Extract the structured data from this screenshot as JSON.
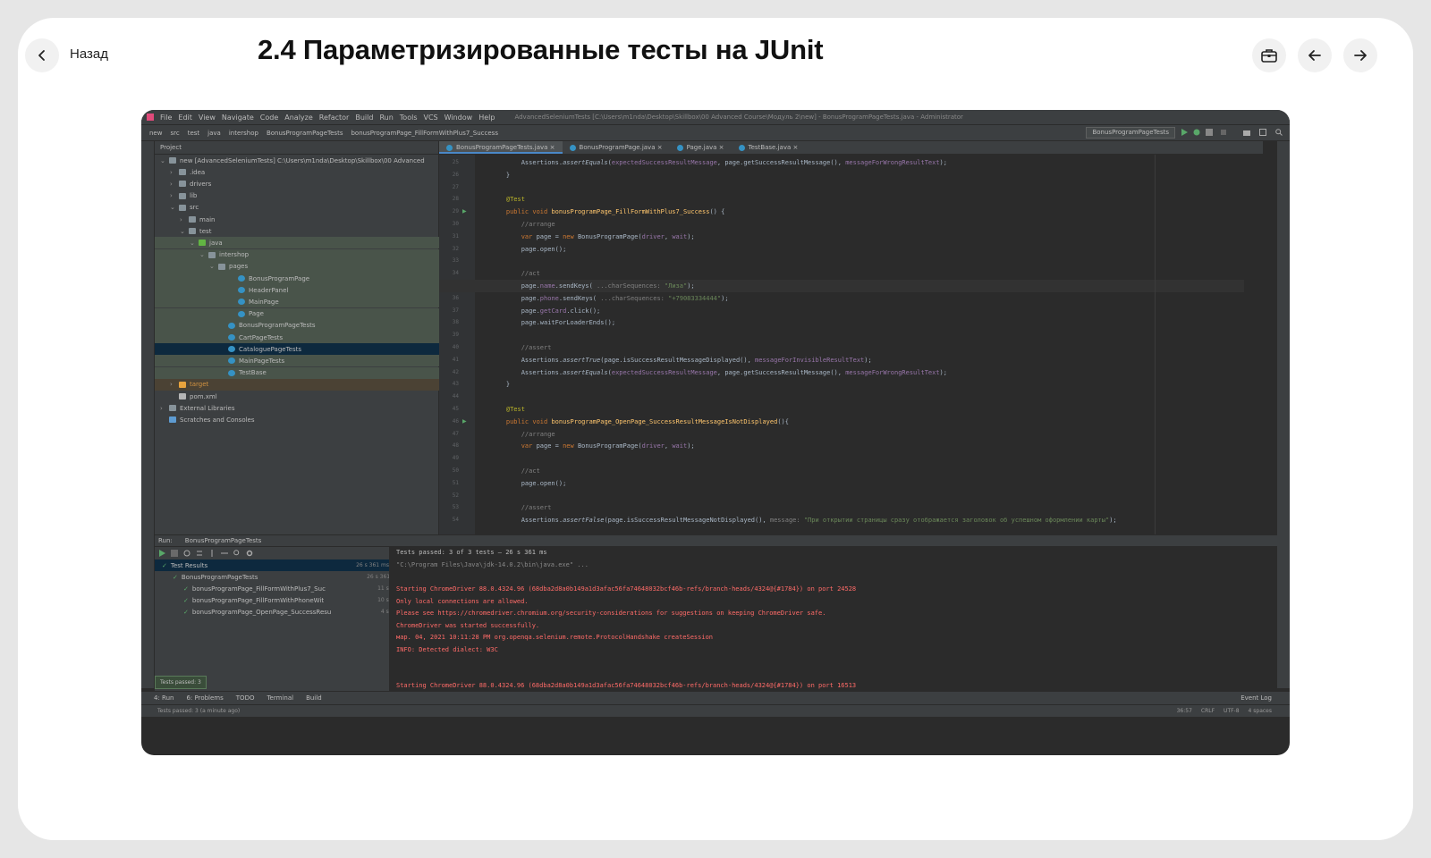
{
  "header": {
    "back_label": "Назад",
    "title": "2.4 Параметризированные тесты на JUnit"
  },
  "ide": {
    "menu": [
      "File",
      "Edit",
      "View",
      "Navigate",
      "Code",
      "Analyze",
      "Refactor",
      "Build",
      "Run",
      "Tools",
      "VCS",
      "Window",
      "Help"
    ],
    "window_title": "AdvancedSeleniumTests [C:\\Users\\m1nda\\Desktop\\Skillbox\\00 Advanced Course\\Модуль 2\\new] - BonusProgramPageTests.java - Administrator",
    "breadcrumbs": [
      "new",
      "src",
      "test",
      "java",
      "intershop",
      "BonusProgramPageTests",
      "bonusProgramPage_FillFormWithPlus7_Success"
    ],
    "run_config": "BonusProgramPageTests",
    "project_header": "Project",
    "tree": [
      {
        "label": "new [AdvancedSeleniumTests]  C:\\Users\\m1nda\\Desktop\\Skillbox\\00 Advanced",
        "indent": 0,
        "arrow": "v",
        "kind": "folder"
      },
      {
        "label": ".idea",
        "indent": 1,
        "arrow": ">",
        "kind": "folder"
      },
      {
        "label": "drivers",
        "indent": 1,
        "arrow": ">",
        "kind": "folder"
      },
      {
        "label": "lib",
        "indent": 1,
        "arrow": ">",
        "kind": "folder"
      },
      {
        "label": "src",
        "indent": 1,
        "arrow": "v",
        "kind": "folder"
      },
      {
        "label": "main",
        "indent": 2,
        "arrow": ">",
        "kind": "folder"
      },
      {
        "label": "test",
        "indent": 2,
        "arrow": "v",
        "kind": "folder"
      },
      {
        "label": "java",
        "indent": 3,
        "arrow": "v",
        "kind": "folder-green",
        "hl": "green"
      },
      {
        "label": "intershop",
        "indent": 4,
        "arrow": "v",
        "kind": "folder",
        "hl": "green"
      },
      {
        "label": "pages",
        "indent": 5,
        "arrow": "v",
        "kind": "folder",
        "hl": "green"
      },
      {
        "label": "BonusProgramPage",
        "indent": 7,
        "arrow": "",
        "kind": "class",
        "hl": "green"
      },
      {
        "label": "HeaderPanel",
        "indent": 7,
        "arrow": "",
        "kind": "class",
        "hl": "green"
      },
      {
        "label": "MainPage",
        "indent": 7,
        "arrow": "",
        "kind": "class",
        "hl": "green"
      },
      {
        "label": "Page",
        "indent": 7,
        "arrow": "",
        "kind": "class",
        "hl": "green"
      },
      {
        "label": "BonusProgramPageTests",
        "indent": 6,
        "arrow": "",
        "kind": "class",
        "hl": "green"
      },
      {
        "label": "CartPageTests",
        "indent": 6,
        "arrow": "",
        "kind": "class",
        "hl": "green"
      },
      {
        "label": "CataloguePageTests",
        "indent": 6,
        "arrow": "",
        "kind": "class",
        "hl": "selected"
      },
      {
        "label": "MainPageTests",
        "indent": 6,
        "arrow": "",
        "kind": "class",
        "hl": "green"
      },
      {
        "label": "TestBase",
        "indent": 6,
        "arrow": "",
        "kind": "class",
        "hl": "green"
      },
      {
        "label": "target",
        "indent": 1,
        "arrow": ">",
        "kind": "folder-orange",
        "hl": "brown"
      },
      {
        "label": "pom.xml",
        "indent": 1,
        "arrow": "",
        "kind": "file"
      },
      {
        "label": "External Libraries",
        "indent": 0,
        "arrow": ">",
        "kind": "lib"
      },
      {
        "label": "Scratches and Consoles",
        "indent": 0,
        "arrow": "",
        "kind": "scratch"
      }
    ],
    "tabs": [
      "BonusProgramPageTests.java",
      "BonusProgramPage.java",
      "Page.java",
      "TestBase.java"
    ],
    "code": [
      {
        "n": "25",
        "html": "        Assertions.<span class=\"i\">assertEquals</span>(<span class=\"p\">expectedSuccessResultMessage</span>, page.getSuccessResultMessage(), <span class=\"p\">messageForWrongResultText</span>);"
      },
      {
        "n": "26",
        "html": "    }"
      },
      {
        "n": "27",
        "html": ""
      },
      {
        "n": "28",
        "html": "    <span class=\"a\">@Test</span>"
      },
      {
        "n": "29",
        "html": "    <span class=\"k\">public void</span> <span class=\"f\">bonusProgramPage_FillFormWithPlus7_Success</span>() {"
      },
      {
        "n": "30",
        "html": "        <span class=\"cm\">//arrange</span>"
      },
      {
        "n": "31",
        "html": "        <span class=\"k\">var</span> page = <span class=\"k\">new</span> BonusProgramPage(<span class=\"p\">driver</span>, <span class=\"p\">wait</span>);"
      },
      {
        "n": "32",
        "html": "        page.open();"
      },
      {
        "n": "33",
        "html": ""
      },
      {
        "n": "34",
        "html": "        <span class=\"cm\">//act</span>"
      },
      {
        "n": "35",
        "html": "        page.<span class=\"p\">name</span>.sendKeys( <span class=\"cm\">...charSequences:</span> <span class=\"s\">\"Лиза\"</span>);",
        "hl": true
      },
      {
        "n": "36",
        "html": "        page.<span class=\"p\">phone</span>.sendKeys( <span class=\"cm\">...charSequences:</span> <span class=\"s\">\"+79083334444\"</span>);"
      },
      {
        "n": "37",
        "html": "        page.<span class=\"p\">getCard</span>.click();"
      },
      {
        "n": "38",
        "html": "        page.waitForLoaderEnds();"
      },
      {
        "n": "39",
        "html": ""
      },
      {
        "n": "40",
        "html": "        <span class=\"cm\">//assert</span>"
      },
      {
        "n": "41",
        "html": "        Assertions.<span class=\"i\">assertTrue</span>(page.isSuccessResultMessageDisplayed(), <span class=\"p\">messageForInvisibleResultText</span>);"
      },
      {
        "n": "42",
        "html": "        Assertions.<span class=\"i\">assertEquals</span>(<span class=\"p\">expectedSuccessResultMessage</span>, page.getSuccessResultMessage(), <span class=\"p\">messageForWrongResultText</span>);"
      },
      {
        "n": "43",
        "html": "    }"
      },
      {
        "n": "44",
        "html": ""
      },
      {
        "n": "45",
        "html": "    <span class=\"a\">@Test</span>"
      },
      {
        "n": "46",
        "html": "    <span class=\"k\">public void</span> <span class=\"f\">bonusProgramPage_OpenPage_SuccessResultMessageIsNotDisplayed</span>(){"
      },
      {
        "n": "47",
        "html": "        <span class=\"cm\">//arrange</span>"
      },
      {
        "n": "48",
        "html": "        <span class=\"k\">var</span> page = <span class=\"k\">new</span> BonusProgramPage(<span class=\"p\">driver</span>, <span class=\"p\">wait</span>);"
      },
      {
        "n": "49",
        "html": ""
      },
      {
        "n": "50",
        "html": "        <span class=\"cm\">//act</span>"
      },
      {
        "n": "51",
        "html": "        page.open();"
      },
      {
        "n": "52",
        "html": ""
      },
      {
        "n": "53",
        "html": "        <span class=\"cm\">//assert</span>"
      },
      {
        "n": "54",
        "html": "        Assertions.<span class=\"i\">assertFalse</span>(page.isSuccessResultMessageNotDisplayed(), <span class=\"cm\">message:</span> <span class=\"s\">\"При открытии страницы сразу отображается заголовок об успешном оформлении карты\"</span>);"
      }
    ],
    "run": {
      "head": "Run:",
      "tab": "BonusProgramPageTests",
      "tests_passed_label": "Tests passed: 3 of 3 tests – 26 s 361 ms",
      "tests": [
        {
          "label": "Test Results",
          "time": "26 s 361 ms",
          "indent": 0
        },
        {
          "label": "BonusProgramPageTests",
          "time": "26 s 361 ms",
          "indent": 1
        },
        {
          "label": "bonusProgramPage_FillFormWithPlus7_Suc",
          "time": "11 s 517 ms",
          "indent": 2
        },
        {
          "label": "bonusProgramPage_FillFormWithPhoneWit",
          "time": "10 s 582 ms",
          "indent": 2
        },
        {
          "label": "bonusProgramPage_OpenPage_SuccessResu",
          "time": "4 s 262 ms",
          "indent": 2
        }
      ],
      "console": [
        {
          "t": "\"C:\\Program Files\\Java\\jdk-14.0.2\\bin\\java.exe\" ...",
          "c": "gray"
        },
        {
          "t": "",
          "c": "gray"
        },
        {
          "t": "Starting ChromeDriver 88.0.4324.96 (68dba2d8a0b149a1d3afac56fa74648032bcf46b-refs/branch-heads/4324@{#1784}) on port 24528",
          "c": "err"
        },
        {
          "t": "Only local connections are allowed.",
          "c": "err"
        },
        {
          "t": "Please see https://chromedriver.chromium.org/security-considerations for suggestions on keeping ChromeDriver safe.",
          "c": "err"
        },
        {
          "t": "ChromeDriver was started successfully.",
          "c": "err"
        },
        {
          "t": "мар. 04, 2021 10:11:28 PM org.openqa.selenium.remote.ProtocolHandshake createSession",
          "c": "err"
        },
        {
          "t": "INFO: Detected dialect: W3C",
          "c": "err"
        },
        {
          "t": "",
          "c": "gray"
        },
        {
          "t": "",
          "c": "gray"
        },
        {
          "t": "Starting ChromeDriver 88.0.4324.96 (68dba2d8a0b149a1d3afac56fa74648032bcf46b-refs/branch-heads/4324@{#1784}) on port 16513",
          "c": "err"
        },
        {
          "t": "Only local connections are allowed.",
          "c": "err"
        }
      ]
    },
    "tooltip": "Tests passed: 3",
    "bottom_tabs": [
      "4: Run",
      "6: Problems",
      "TODO",
      "Terminal",
      "Build"
    ],
    "event_log": "Event Log",
    "status_left": "Tests passed: 3 (a minute ago)",
    "status_right": [
      "36:57",
      "CRLF",
      "UTF-8",
      "4 spaces"
    ]
  }
}
